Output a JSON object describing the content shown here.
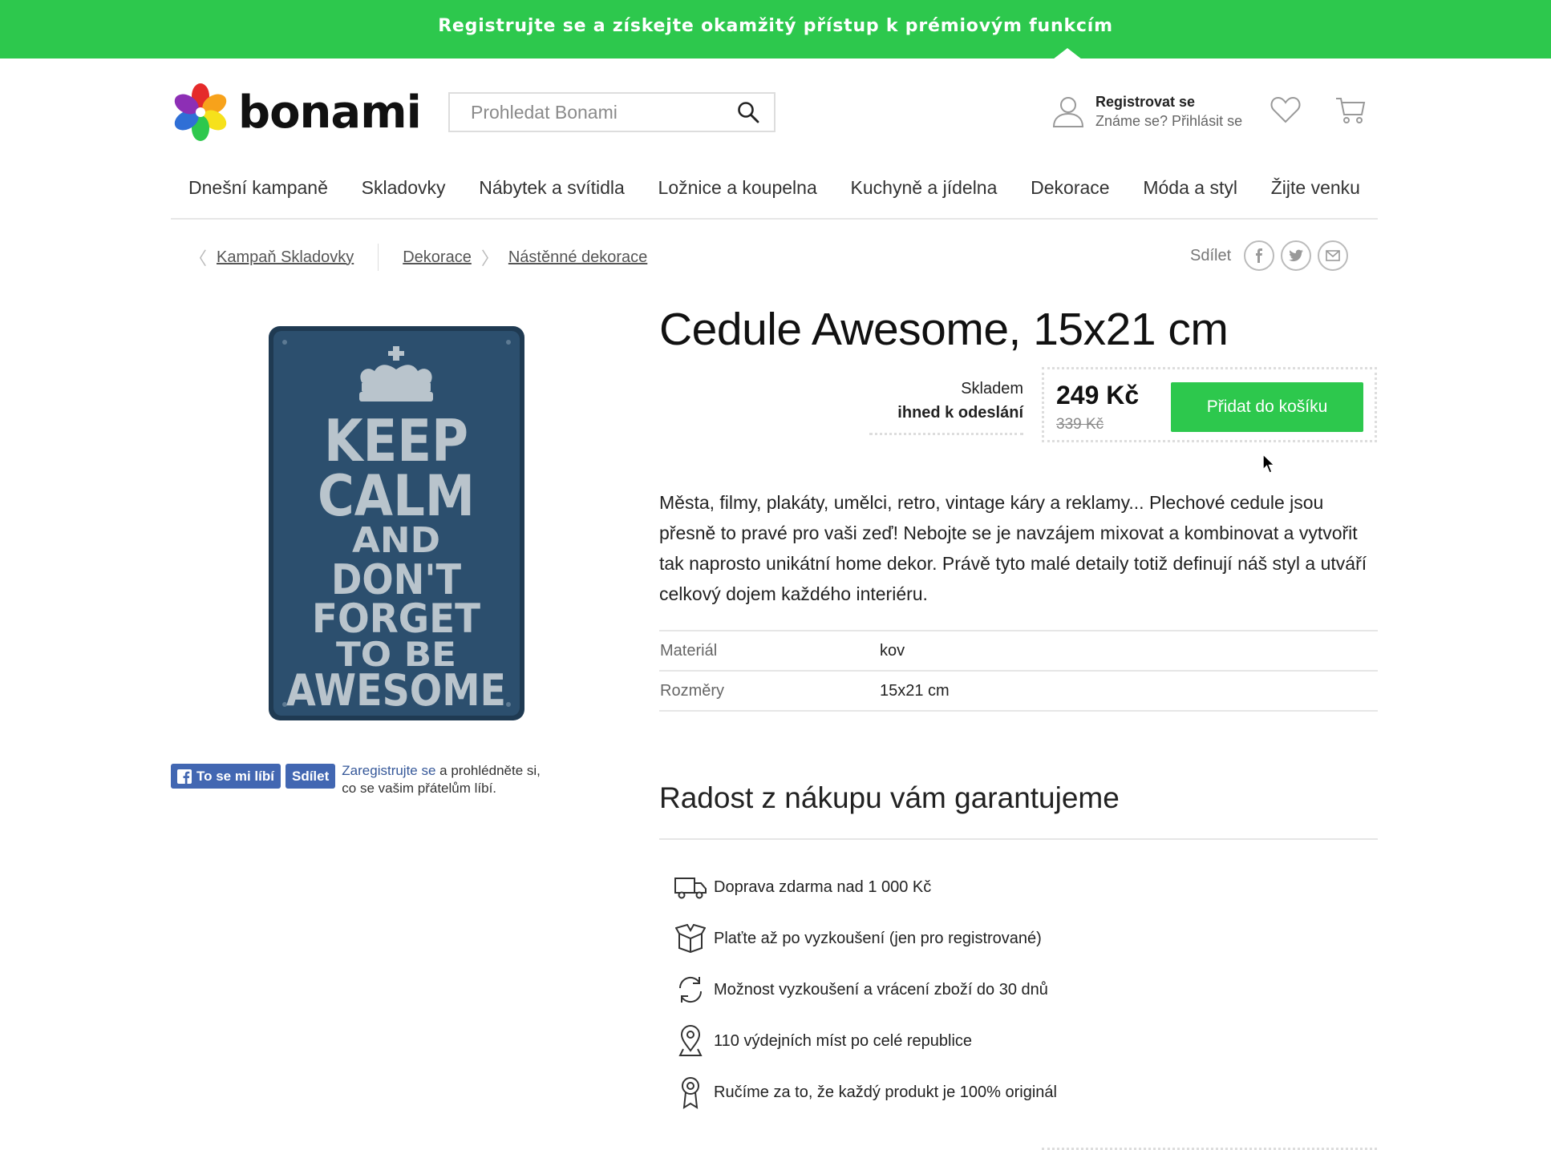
{
  "promo": {
    "text": "Registrujte se a získejte okamžitý přístup k prémiovým funkcím"
  },
  "header": {
    "logo_text": "bonami",
    "search_placeholder": "Prohledat Bonami",
    "account": {
      "register": "Registrovat se",
      "login": "Známe se? Přihlásit se"
    }
  },
  "nav": [
    "Dnešní kampaně",
    "Skladovky",
    "Nábytek a svítidla",
    "Ložnice a koupelna",
    "Kuchyně a jídelna",
    "Dekorace",
    "Móda a styl",
    "Žijte venku"
  ],
  "breadcrumbs": {
    "back": "Kampaň Skladovky",
    "items": [
      "Dekorace",
      "Nástěnné dekorace"
    ]
  },
  "share": {
    "label": "Sdílet"
  },
  "product": {
    "title": "Cedule Awesome, 15x21 cm",
    "stock": "Skladem",
    "shipping": "ihned k odeslání",
    "price": "249 Kč",
    "old_price": "339 Kč",
    "add_to_cart": "Přidat do košíku",
    "description": "Města, filmy, plakáty, umělci, retro, vintage káry a reklamy... Plechové cedule jsou přesně to pravé pro vaši zeď! Nebojte se je navzájem mixovat a kombinovat a vytvořit tak naprosto unikátní home dekor. Právě tyto malé detaily totiž definují náš styl a utváří celkový dojem každého interiéru.",
    "specs": [
      {
        "key": "Materiál",
        "value": "kov"
      },
      {
        "key": "Rozměry",
        "value": "15x21 cm"
      }
    ],
    "image_text": [
      "KEEP",
      "CALM",
      "AND",
      "DON'T",
      "FORGET",
      "TO BE",
      "AWESOME"
    ]
  },
  "facebook": {
    "like": "To se mi líbí",
    "share": "Sdílet",
    "register_link": "Zaregistrujte se",
    "text1": " a prohlédněte si,",
    "text2": "co se vašim přátelům líbí."
  },
  "guarantee": {
    "title": "Radost z nákupu vám garantujeme",
    "items": [
      {
        "icon": "truck-icon",
        "text": "Doprava zdarma nad 1 000 Kč"
      },
      {
        "icon": "box-icon",
        "text": "Plaťte až po vyzkoušení (jen pro registrované)"
      },
      {
        "icon": "refresh-icon",
        "text": "Možnost vyzkoušení a vrácení zboží do 30 dnů"
      },
      {
        "icon": "pin-icon",
        "text": "110 výdejních míst po celé republice"
      },
      {
        "icon": "award-icon",
        "text": "Ručíme za to, že každý produkt je 100% originál"
      }
    ]
  },
  "colors": {
    "brand_green": "#2dc84d",
    "sign_blue": "#2c4f6e",
    "facebook_blue": "#4267b2"
  }
}
